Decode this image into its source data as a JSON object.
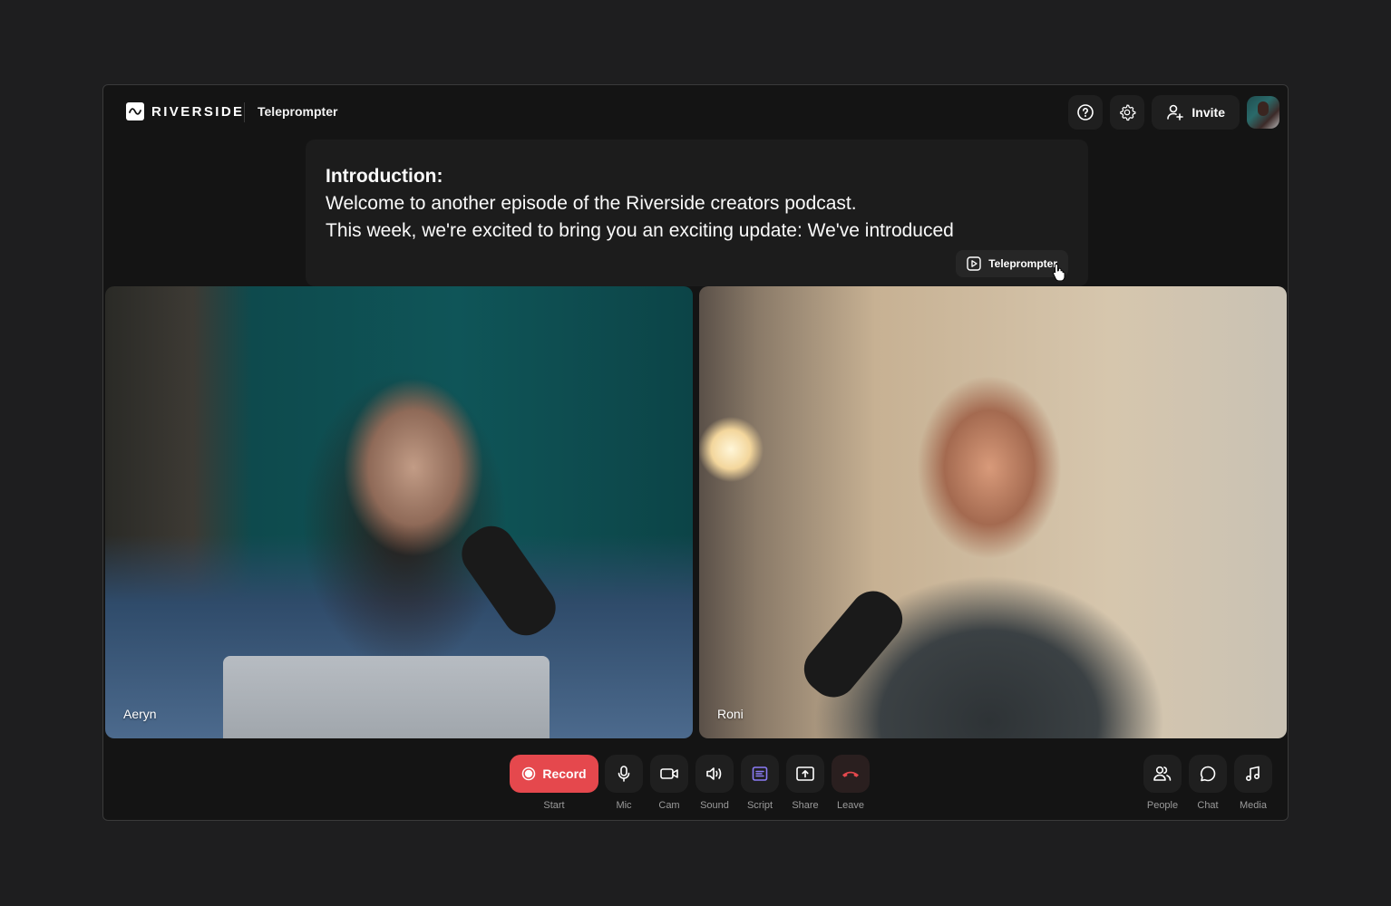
{
  "app": {
    "brand": "RIVERSIDE",
    "page_title": "Teleprompter"
  },
  "header": {
    "help_icon": "help-circle-icon",
    "settings_icon": "gear-icon",
    "invite_label": "Invite",
    "invite_icon": "user-plus-icon"
  },
  "teleprompter": {
    "heading": "Introduction:",
    "lines": [
      "Welcome to another episode of the Riverside creators podcast.",
      "This week, we're excited to bring you an exciting update: We've introduced"
    ],
    "button_label": "Teleprompter",
    "button_icon": "play-square-icon"
  },
  "participants": [
    {
      "name": "Aeryn"
    },
    {
      "name": "Roni"
    }
  ],
  "controls": {
    "record": {
      "label": "Record",
      "caption": "Start",
      "color": "#e5484d"
    },
    "items": [
      {
        "id": "mic",
        "label": "Mic",
        "icon": "microphone-icon"
      },
      {
        "id": "cam",
        "label": "Cam",
        "icon": "camera-icon"
      },
      {
        "id": "sound",
        "label": "Sound",
        "icon": "speaker-icon"
      },
      {
        "id": "script",
        "label": "Script",
        "icon": "script-icon",
        "color": "#8b7cf6"
      },
      {
        "id": "share",
        "label": "Share",
        "icon": "share-screen-icon"
      },
      {
        "id": "leave",
        "label": "Leave",
        "icon": "phone-hangup-icon",
        "color": "#e5484d"
      }
    ],
    "right": [
      {
        "id": "people",
        "label": "People",
        "icon": "people-icon"
      },
      {
        "id": "chat",
        "label": "Chat",
        "icon": "chat-icon"
      },
      {
        "id": "media",
        "label": "Media",
        "icon": "music-note-icon"
      }
    ]
  }
}
